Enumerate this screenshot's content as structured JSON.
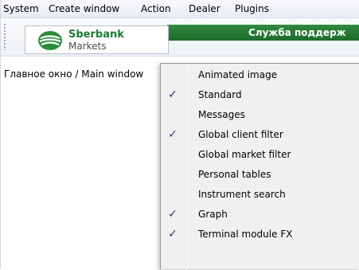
{
  "menubar": {
    "items": [
      "System",
      "Create window",
      "Action",
      "Dealer",
      "Plugins"
    ]
  },
  "toolbar": {
    "logo_line1": "Sberbank",
    "logo_line2": "Markets",
    "support_text": "Служба поддерж"
  },
  "main": {
    "breadcrumb": "Главное окно / Main window"
  },
  "popup_menu": {
    "items": [
      {
        "label": "Animated image",
        "checked": false
      },
      {
        "label": "Standard",
        "checked": true,
        "check_glyph": "✓"
      },
      {
        "label": "Messages",
        "checked": false
      },
      {
        "label": "Global client filter",
        "checked": true,
        "check_glyph": "✓"
      },
      {
        "label": "Global market filter",
        "checked": false
      },
      {
        "label": "Personal tables",
        "checked": false
      },
      {
        "label": "Instrument search",
        "checked": false
      },
      {
        "label": "Graph",
        "checked": true,
        "check_glyph": "✓"
      },
      {
        "label": "Terminal module FX",
        "checked": true,
        "check_glyph": "✓"
      }
    ]
  },
  "colors": {
    "brand_green": "#1f7a34",
    "menu_bg": "#f0f0f0",
    "check_color": "#2a3a6a"
  }
}
